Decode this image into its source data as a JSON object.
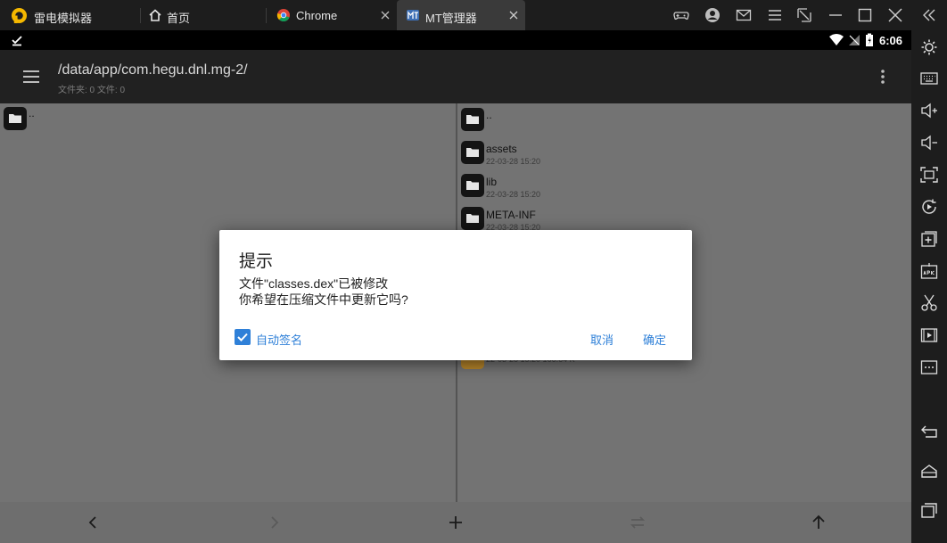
{
  "titlebar": {
    "app_name": "雷电模拟器",
    "tabs": [
      {
        "label": "首页",
        "icon": "home-icon"
      },
      {
        "label": "Chrome",
        "icon": "chrome-icon"
      },
      {
        "label": "MT管理器",
        "icon": "mt-manager-icon",
        "active": true
      }
    ],
    "window_controls": [
      "gamepad-icon",
      "account-icon",
      "mail-icon",
      "menu-icon",
      "restore-resize-icon",
      "minimize-icon",
      "maximize-icon",
      "close-icon",
      "collapse-sidebar-icon"
    ]
  },
  "statusbar": {
    "time": "6:06"
  },
  "appbar": {
    "path": "/data/app/com.hegu.dnl.mg-2/",
    "subpath": "文件夹: 0  文件: 0"
  },
  "left_pane": {
    "items": [
      {
        "name": ".."
      }
    ]
  },
  "right_pane": {
    "items": [
      {
        "name": "..",
        "date": ""
      },
      {
        "name": "assets",
        "date": "22-03-28 15:20"
      },
      {
        "name": "lib",
        "date": "22-03-28 15:20"
      },
      {
        "name": "META-INF",
        "date": "22-03-28 15:20"
      }
    ],
    "partial_row_text": "22-03-28 15:20  166.64 K"
  },
  "dialog": {
    "title": "提示",
    "message_line1": "文件\"classes.dex\"已被修改",
    "message_line2": "你希望在压缩文件中更新它吗?",
    "checkbox_label": "自动签名",
    "checkbox_checked": true,
    "cancel_label": "取消",
    "ok_label": "确定"
  },
  "bottom_bar": [
    "back-arrow-icon",
    "forward-arrow-icon",
    "add-icon",
    "swap-icon",
    "up-arrow-icon"
  ],
  "sidebar": [
    "settings-icon",
    "keyboard-icon",
    "volume-up-icon",
    "volume-down-icon",
    "fullscreen-icon",
    "rotate-icon",
    "add-window-icon",
    "apk-install-icon",
    "screenshot-scissors-icon",
    "video-record-icon",
    "more-icon",
    "android-back-icon",
    "android-home-icon",
    "android-recents-icon"
  ],
  "colors": {
    "accent": "#2f80d8",
    "pane": "#737373",
    "toolbar": "#212121"
  }
}
